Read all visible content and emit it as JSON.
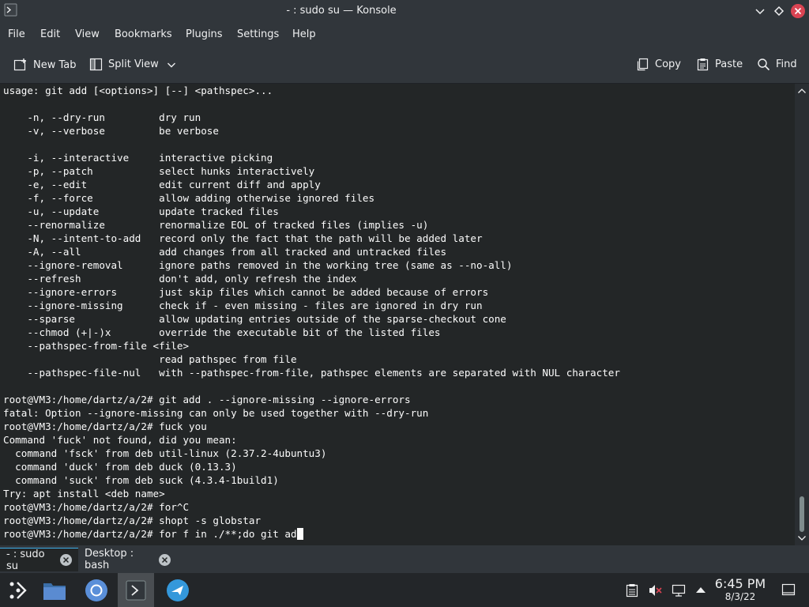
{
  "window": {
    "title": "- : sudo su — Konsole"
  },
  "menu": [
    "File",
    "Edit",
    "View",
    "Bookmarks",
    "Plugins",
    "Settings",
    "Help"
  ],
  "toolbar": {
    "new_tab": "New Tab",
    "split_view": "Split View",
    "copy": "Copy",
    "paste": "Paste",
    "find": "Find"
  },
  "terminal": {
    "lines": [
      "usage: git add [<options>] [--] <pathspec>...",
      "",
      "    -n, --dry-run         dry run",
      "    -v, --verbose         be verbose",
      "",
      "    -i, --interactive     interactive picking",
      "    -p, --patch           select hunks interactively",
      "    -e, --edit            edit current diff and apply",
      "    -f, --force           allow adding otherwise ignored files",
      "    -u, --update          update tracked files",
      "    --renormalize         renormalize EOL of tracked files (implies -u)",
      "    -N, --intent-to-add   record only the fact that the path will be added later",
      "    -A, --all             add changes from all tracked and untracked files",
      "    --ignore-removal      ignore paths removed in the working tree (same as --no-all)",
      "    --refresh             don't add, only refresh the index",
      "    --ignore-errors       just skip files which cannot be added because of errors",
      "    --ignore-missing      check if - even missing - files are ignored in dry run",
      "    --sparse              allow updating entries outside of the sparse-checkout cone",
      "    --chmod (+|-)x        override the executable bit of the listed files",
      "    --pathspec-from-file <file>",
      "                          read pathspec from file",
      "    --pathspec-file-nul   with --pathspec-from-file, pathspec elements are separated with NUL character",
      "",
      "root@VM3:/home/dartz/a/2# git add . --ignore-missing --ignore-errors",
      "fatal: Option --ignore-missing can only be used together with --dry-run",
      "root@VM3:/home/dartz/a/2# fuck you",
      "Command 'fuck' not found, did you mean:",
      "  command 'fsck' from deb util-linux (2.37.2-4ubuntu3)",
      "  command 'duck' from deb duck (0.13.3)",
      "  command 'suck' from deb suck (4.3.4-1build1)",
      "Try: apt install <deb name>",
      "root@VM3:/home/dartz/a/2# for^C",
      "root@VM3:/home/dartz/a/2# shopt -s globstar",
      "root@VM3:/home/dartz/a/2# for f in ./**;do git ad"
    ]
  },
  "tabs": [
    {
      "label": "- : sudo su",
      "active": true
    },
    {
      "label": "Desktop : bash",
      "active": false
    }
  ],
  "clock": {
    "time": "6:45 PM",
    "date": "8/3/22"
  },
  "colors": {
    "terminal_bg": "#232627",
    "chrome_bg": "#31363b",
    "accent": "#3daee9",
    "close_red": "#da4453"
  }
}
